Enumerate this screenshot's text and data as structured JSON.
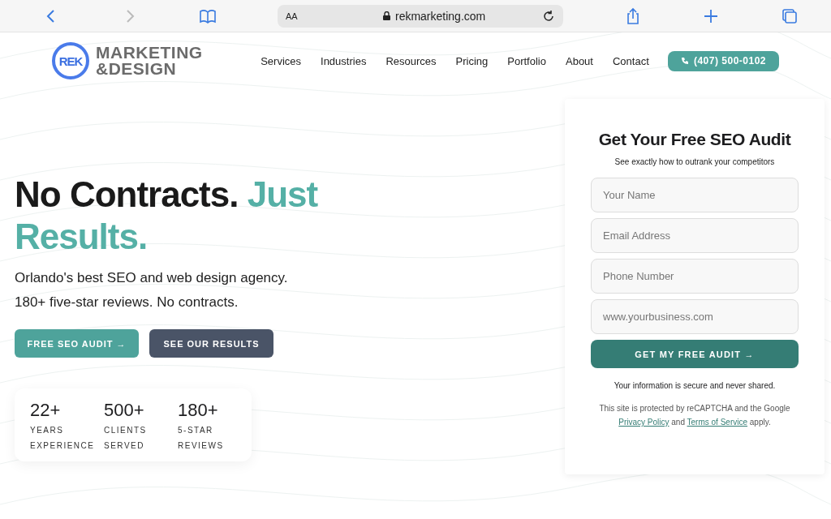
{
  "browser": {
    "text_size": "AA",
    "url": "rekmarketing.com"
  },
  "logo": {
    "mark": "REK",
    "lines": [
      "MARKETING",
      "&DESIGN"
    ]
  },
  "nav": {
    "links": [
      "Services",
      "Industries",
      "Resources",
      "Pricing",
      "Portfolio",
      "About",
      "Contact"
    ],
    "phone": "(407) 500-0102"
  },
  "hero": {
    "headline": "No Contracts.",
    "headline_accent": "Just Results.",
    "subtitle_lines": [
      "Orlando's best SEO and web design agency.",
      "180+ five-star reviews. No contracts."
    ],
    "buttons": [
      {
        "label": "FREE SEO AUDIT →",
        "kind": "primary"
      },
      {
        "label": "SEE OUR RESULTS",
        "kind": "secondary"
      }
    ],
    "stats": [
      {
        "value": "22+",
        "label_lines": [
          "YEARS",
          "EXPERIENCE"
        ]
      },
      {
        "value": "500+",
        "label_lines": [
          "CLIENTS",
          "SERVED"
        ]
      },
      {
        "value": "180+",
        "label_lines": [
          "5-STAR",
          "REVIEWS"
        ]
      }
    ]
  },
  "form": {
    "title": "Get Your Free SEO Audit",
    "subtitle": "See exactly how to outrank your competitors",
    "fields": [
      {
        "placeholder": "Your Name"
      },
      {
        "placeholder": "Email Address"
      },
      {
        "placeholder": "Phone Number"
      },
      {
        "placeholder": "www.yourbusiness.com"
      }
    ],
    "submit": "GET MY FREE AUDIT →",
    "secure_note": "Your information is secure and never shared.",
    "legal": {
      "prefix": "This site is protected by reCAPTCHA and the Google",
      "links": [
        "Privacy Policy",
        "Terms of Service"
      ],
      "joiner": "and",
      "suffix": "apply."
    }
  }
}
